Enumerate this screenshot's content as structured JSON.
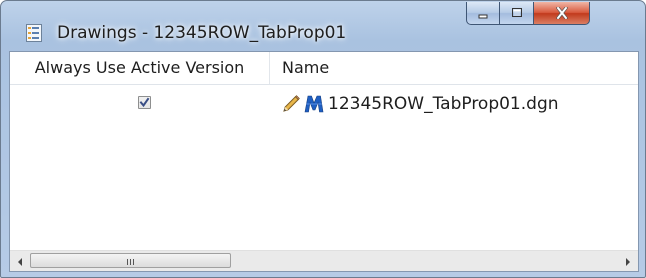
{
  "window": {
    "title": "Drawings - 12345ROW_TabProp01",
    "app_icon": "document-list-icon"
  },
  "title_buttons": {
    "minimize_icon": "minimize-icon",
    "maximize_icon": "maximize-icon",
    "close_icon": "close-icon"
  },
  "table": {
    "columns": [
      "Always Use Active Version",
      "Name"
    ],
    "rows": [
      {
        "always_use_active_version": true,
        "name": "12345ROW_TabProp01.dgn",
        "icons": [
          "pencil-icon",
          "microstation-icon"
        ]
      }
    ]
  },
  "colors": {
    "title_bar": "#b9cfe9",
    "close_button": "#c8482a",
    "checkmark": "#3a4f86"
  }
}
